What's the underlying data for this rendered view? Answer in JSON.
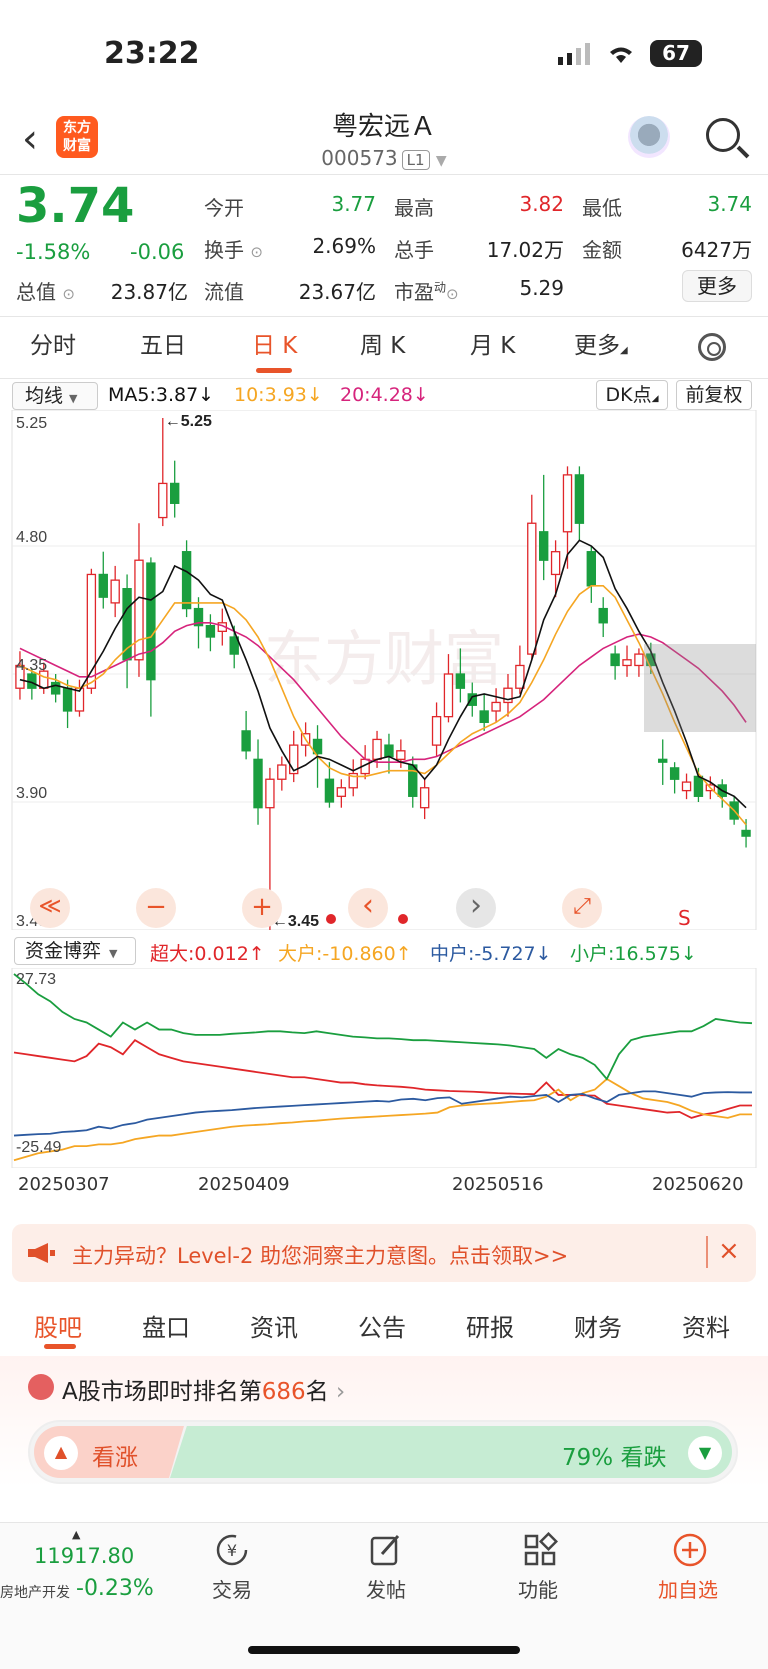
{
  "status": {
    "time": "23:22",
    "battery": "67"
  },
  "header": {
    "name": "粤宏远Ａ",
    "code": "000573",
    "level": "L1",
    "logo_line1": "东方",
    "logo_line2": "财富"
  },
  "quote": {
    "price": "3.74",
    "change_pct": "-1.58%",
    "change": "-0.06",
    "open_label": "今开",
    "open": "3.77",
    "high_label": "最高",
    "high": "3.82",
    "low_label": "最低",
    "low": "3.74",
    "turnover_label": "换手",
    "turnover": "2.69%",
    "volume_label": "总手",
    "volume": "17.02万",
    "amount_label": "金额",
    "amount": "6427万",
    "mktcap_label": "总值",
    "mktcap": "23.87亿",
    "float_label": "流值",
    "float": "23.67亿",
    "pe_label": "市盈",
    "pe_sup": "动",
    "pe": "5.29",
    "more": "更多"
  },
  "tabs": [
    "分时",
    "五日",
    "日 K",
    "周 K",
    "月 K",
    "更多"
  ],
  "active_tab": 2,
  "ma_bar": {
    "select": "均线",
    "ma5": "MA5:3.87↓",
    "ma10": "10:3.93↓",
    "ma20": "20:4.28↓",
    "dk": "DK点",
    "fq": "前复权",
    "colors": {
      "ma5": "#111111",
      "ma10": "#f5a623",
      "ma20": "#d6247c"
    }
  },
  "flow_bar": {
    "select": "资金博弈",
    "super": "超大:0.012↑",
    "big": "大户:-10.860↑",
    "mid": "中户:-5.727↓",
    "small": "小户:16.575↓"
  },
  "chart_data": [
    {
      "type": "candlestick",
      "y_ticks": [
        "5.25",
        "4.80",
        "4.35",
        "3.90",
        "3.45"
      ],
      "ylim": [
        3.45,
        5.25
      ],
      "annotations": {
        "high_mark": "←5.25",
        "low_mark": "←3.45",
        "signal": "S"
      },
      "candles": [
        [
          4.3,
          4.38,
          4.43,
          4.26
        ],
        [
          4.35,
          4.3,
          4.37,
          4.26
        ],
        [
          4.3,
          4.36,
          4.39,
          4.28
        ],
        [
          4.32,
          4.28,
          4.35,
          4.25
        ],
        [
          4.3,
          4.22,
          4.33,
          4.16
        ],
        [
          4.22,
          4.3,
          4.33,
          4.2
        ],
        [
          4.3,
          4.7,
          4.72,
          4.28
        ],
        [
          4.7,
          4.62,
          4.78,
          4.58
        ],
        [
          4.6,
          4.68,
          4.73,
          4.55
        ],
        [
          4.65,
          4.4,
          4.7,
          4.3
        ],
        [
          4.4,
          4.75,
          4.88,
          4.34
        ],
        [
          4.74,
          4.33,
          4.76,
          4.2
        ],
        [
          4.9,
          5.02,
          5.25,
          4.87
        ],
        [
          5.02,
          4.95,
          5.1,
          4.9
        ],
        [
          4.78,
          4.58,
          4.82,
          4.55
        ],
        [
          4.58,
          4.52,
          4.62,
          4.44
        ],
        [
          4.52,
          4.48,
          4.56,
          4.43
        ],
        [
          4.5,
          4.53,
          4.58,
          4.45
        ],
        [
          4.48,
          4.42,
          4.52,
          4.37
        ],
        [
          4.15,
          4.08,
          4.22,
          4.05
        ],
        [
          4.05,
          3.88,
          4.12,
          3.82
        ],
        [
          3.88,
          3.98,
          4.02,
          3.45
        ],
        [
          3.98,
          4.03,
          4.06,
          3.94
        ],
        [
          4.0,
          4.1,
          4.15,
          3.97
        ],
        [
          4.1,
          4.14,
          4.18,
          4.06
        ],
        [
          4.12,
          4.07,
          4.17,
          3.95
        ],
        [
          3.98,
          3.9,
          4.04,
          3.88
        ],
        [
          3.92,
          3.95,
          3.98,
          3.88
        ],
        [
          3.95,
          4.0,
          4.05,
          3.92
        ],
        [
          4.0,
          4.05,
          4.1,
          3.98
        ],
        [
          4.05,
          4.12,
          4.15,
          4.02
        ],
        [
          4.1,
          4.06,
          4.14,
          4.0
        ],
        [
          4.05,
          4.08,
          4.12,
          4.02
        ],
        [
          4.03,
          3.92,
          4.06,
          3.88
        ],
        [
          3.88,
          3.95,
          3.98,
          3.84
        ],
        [
          4.1,
          4.2,
          4.25,
          4.06
        ],
        [
          4.2,
          4.35,
          4.42,
          4.18
        ],
        [
          4.35,
          4.3,
          4.44,
          4.25
        ],
        [
          4.28,
          4.24,
          4.32,
          4.2
        ],
        [
          4.22,
          4.18,
          4.28,
          4.15
        ],
        [
          4.22,
          4.25,
          4.3,
          4.18
        ],
        [
          4.25,
          4.3,
          4.35,
          4.2
        ],
        [
          4.3,
          4.38,
          4.45,
          4.28
        ],
        [
          4.42,
          4.88,
          4.98,
          4.4
        ],
        [
          4.85,
          4.75,
          5.05,
          4.68
        ],
        [
          4.7,
          4.78,
          4.82,
          4.62
        ],
        [
          4.85,
          5.05,
          5.08,
          4.72
        ],
        [
          5.05,
          4.88,
          5.08,
          4.82
        ],
        [
          4.78,
          4.66,
          4.8,
          4.6
        ],
        [
          4.58,
          4.53,
          4.62,
          4.48
        ],
        [
          4.42,
          4.38,
          4.45,
          4.33
        ],
        [
          4.38,
          4.4,
          4.45,
          4.34
        ],
        [
          4.38,
          4.42,
          4.44,
          4.34
        ],
        [
          4.42,
          4.38,
          4.46,
          4.35
        ],
        [
          4.05,
          4.04,
          4.12,
          3.96
        ],
        [
          4.02,
          3.98,
          4.04,
          3.93
        ],
        [
          3.94,
          3.97,
          4.0,
          3.91
        ],
        [
          3.99,
          3.92,
          4.02,
          3.9
        ],
        [
          3.94,
          3.96,
          3.99,
          3.91
        ],
        [
          3.96,
          3.92,
          3.98,
          3.88
        ],
        [
          3.9,
          3.84,
          3.92,
          3.82
        ],
        [
          3.8,
          3.78,
          3.84,
          3.74
        ]
      ],
      "ma5": [
        4.33,
        4.32,
        4.3,
        4.31,
        4.3,
        4.29,
        4.36,
        4.43,
        4.51,
        4.58,
        4.62,
        4.61,
        4.64,
        4.73,
        4.71,
        4.68,
        4.63,
        4.61,
        4.5,
        4.4,
        4.29,
        4.16,
        4.08,
        4.01,
        4.03,
        4.06,
        4.05,
        4.03,
        4.01,
        4.03,
        4.05,
        4.06,
        4.04,
        4.03,
        3.98,
        4.03,
        4.12,
        4.2,
        4.27,
        4.28,
        4.27,
        4.26,
        4.27,
        4.4,
        4.54,
        4.63,
        4.77,
        4.82,
        4.8,
        4.76,
        4.65,
        4.58,
        4.5,
        4.43,
        4.32,
        4.22,
        4.11,
        3.99,
        3.97,
        3.94,
        3.92,
        3.88
      ],
      "ma10": [
        4.38,
        4.36,
        4.34,
        4.33,
        4.31,
        4.3,
        4.32,
        4.35,
        4.4,
        4.44,
        4.47,
        4.48,
        4.54,
        4.6,
        4.6,
        4.6,
        4.6,
        4.6,
        4.58,
        4.54,
        4.48,
        4.4,
        4.3,
        4.2,
        4.12,
        4.06,
        4.02,
        4.0,
        3.99,
        3.99,
        4.0,
        4.01,
        4.01,
        4.01,
        4.0,
        4.03,
        4.07,
        4.11,
        4.14,
        4.16,
        4.18,
        4.21,
        4.25,
        4.32,
        4.4,
        4.49,
        4.57,
        4.63,
        4.66,
        4.66,
        4.62,
        4.54,
        4.46,
        4.37,
        4.28,
        4.18,
        4.09,
        4.0,
        3.95,
        3.91,
        3.87,
        3.82
      ],
      "ma20": [
        4.44,
        4.42,
        4.4,
        4.38,
        4.36,
        4.34,
        4.34,
        4.36,
        4.38,
        4.4,
        4.42,
        4.43,
        4.46,
        4.5,
        4.52,
        4.53,
        4.53,
        4.52,
        4.5,
        4.48,
        4.45,
        4.41,
        4.37,
        4.33,
        4.28,
        4.23,
        4.18,
        4.13,
        4.09,
        4.05,
        4.04,
        4.04,
        4.04,
        4.05,
        4.05,
        4.06,
        4.08,
        4.1,
        4.12,
        4.14,
        4.16,
        4.18,
        4.2,
        4.23,
        4.26,
        4.3,
        4.34,
        4.38,
        4.41,
        4.44,
        4.46,
        4.48,
        4.49,
        4.48,
        4.46,
        4.43,
        4.4,
        4.37,
        4.33,
        4.29,
        4.24,
        4.18
      ]
    },
    {
      "type": "line",
      "y_ticks": [
        "27.73",
        "-25.49"
      ],
      "ylim": [
        -25.49,
        27.73
      ],
      "x_ticks": [
        "20250307",
        "20250409",
        "20250516",
        "20250620"
      ],
      "series": [
        {
          "name": "超大",
          "color": "#e0262a",
          "values": [
            5.5,
            5,
            4.5,
            4,
            3.5,
            3,
            4.5,
            8,
            7,
            5,
            9,
            7,
            5,
            4,
            3,
            2.5,
            2,
            1.5,
            1,
            0.5,
            0,
            -0.5,
            -1,
            -1.5,
            -1.5,
            -2,
            -2.5,
            -3,
            -3,
            -3.5,
            -3.8,
            -4,
            -4.2,
            -4.5,
            -5,
            -5.2,
            -5.4,
            -5.5,
            -5.6,
            -5.8,
            -6,
            -6.1,
            -6.2,
            -6.3,
            -3,
            -6.5,
            -6.5,
            -6.6,
            -6.7,
            -9,
            -9.5,
            -10,
            -10.5,
            -11,
            -11.5,
            -11.3,
            -13,
            -12,
            -11.5,
            -10.5,
            -9.5,
            -9.5
          ]
        },
        {
          "name": "大户",
          "color": "#f5a623",
          "values": [
            -25,
            -24,
            -23,
            -22.5,
            -22,
            -21,
            -21,
            -20.5,
            -20.5,
            -20,
            -19,
            -18.5,
            -18,
            -18,
            -17.5,
            -17,
            -16.5,
            -16,
            -15.5,
            -15.2,
            -15,
            -14.8,
            -14.5,
            -14.3,
            -14,
            -13.8,
            -13.5,
            -13.2,
            -13,
            -12.8,
            -12.6,
            -12.4,
            -12.2,
            -12,
            -11.8,
            -11.5,
            -10,
            -9.5,
            -9.2,
            -9,
            -8.8,
            -8.5,
            -8.2,
            -8,
            -7,
            -5,
            -8,
            -6,
            -5,
            -2,
            -4,
            -6,
            -7.5,
            -8,
            -8.5,
            -9.5,
            -11,
            -12,
            -12.5,
            -13,
            -12,
            -12
          ]
        },
        {
          "name": "中户",
          "color": "#2c5aa0",
          "values": [
            -18,
            -17.8,
            -17.6,
            -17.5,
            -17,
            -16.8,
            -16.5,
            -15.5,
            -16,
            -15,
            -14.5,
            -13.5,
            -13,
            -12.5,
            -12,
            -11.5,
            -11.2,
            -11,
            -10.8,
            -10.5,
            -10.2,
            -10,
            -9.8,
            -9.6,
            -9.4,
            -9.2,
            -9,
            -8.8,
            -8.6,
            -8.4,
            -8.2,
            -8.4,
            -7.8,
            -7.6,
            -8,
            -7.4,
            -7.2,
            -9,
            -8.5,
            -8,
            -7.5,
            -7,
            -7.2,
            -6.8,
            -6.5,
            -8.5,
            -6.5,
            -6.2,
            -7.5,
            -8.5,
            -6.5,
            -6,
            -5.5,
            -5.5,
            -6,
            -6.5,
            -7,
            -6,
            -5.8,
            -5.7,
            -5.8,
            -5.8
          ]
        },
        {
          "name": "小户",
          "color": "#1a9e3f",
          "values": [
            27.73,
            25,
            22,
            20,
            17,
            15,
            14,
            12,
            10,
            14,
            12,
            14,
            12,
            12,
            11,
            10.5,
            10.5,
            10.5,
            10.8,
            11,
            11.2,
            11.5,
            11.5,
            11.2,
            11,
            11.5,
            11,
            10.5,
            10,
            9.8,
            9.5,
            9.5,
            9.3,
            9,
            9,
            8.8,
            8.6,
            8.4,
            8.2,
            8,
            7.8,
            7.5,
            7,
            6.5,
            4,
            6.5,
            5,
            4,
            2,
            -2,
            5,
            9,
            10,
            10.5,
            11,
            11.5,
            11.5,
            13,
            15,
            14.5,
            14,
            13.8
          ]
        }
      ]
    }
  ],
  "banner": {
    "text": "主力异动？Level-2 助您洞察主力意图。点击领取>>",
    "close": "×"
  },
  "bottom_tabs": [
    "股吧",
    "盘口",
    "资讯",
    "公告",
    "研报",
    "财务",
    "资料"
  ],
  "rank": {
    "prefix": "A股市场即时排名第",
    "num": "686",
    "suffix": "名",
    "arrow": "›"
  },
  "vote": {
    "up": "看涨",
    "down_pct": "79%",
    "down": "看跌"
  },
  "nav": {
    "index_value": "11917.80",
    "index_name": "房地产开发",
    "index_change": "-0.23%",
    "trade": "交易",
    "post": "发帖",
    "func": "功能",
    "add": "加自选"
  },
  "chart_ctrl": {
    "rewind": "≪",
    "minus": "−",
    "plus": "+",
    "prev": "‹",
    "next": "›",
    "expand": "⤢"
  }
}
